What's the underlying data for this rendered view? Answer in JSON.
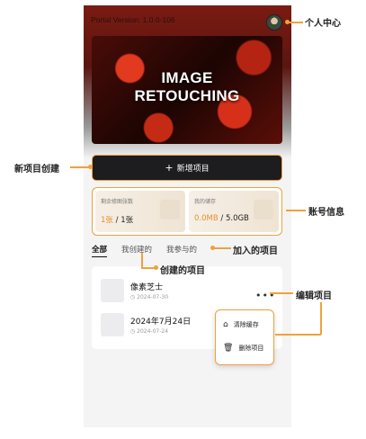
{
  "app": {
    "version_text": "Portal Version: 1.0.0-106",
    "banner_title_line1": "IMAGE",
    "banner_title_line2": "RETOUCHING",
    "new_project_label": "新增项目"
  },
  "account": {
    "remaining_label": "剩余修图张数",
    "remaining_used": "1张",
    "remaining_total": " / 1张",
    "storage_label": "我的储存",
    "storage_used": "0.0MB",
    "storage_total": " / 5.0GB"
  },
  "tabs": [
    {
      "label": "全部",
      "active": true
    },
    {
      "label": "我创建的",
      "active": false
    },
    {
      "label": "我参与的",
      "active": false
    }
  ],
  "projects": [
    {
      "title": "像素芝士",
      "date": "2024-07-30"
    },
    {
      "title": "2024年7月24日",
      "date": "2024-07-24"
    }
  ],
  "more_menu": {
    "more_symbol": "•••",
    "items": [
      {
        "label": "清除缓存",
        "icon": "broom-icon"
      },
      {
        "label": "删除项目",
        "icon": "trash-icon"
      }
    ]
  },
  "annotations": {
    "personal_center": "个人中心",
    "new_project": "新项目创建",
    "account_info": "账号信息",
    "joined_projects": "加入的项目",
    "created_projects": "创建的项目",
    "edit_project": "编辑项目"
  },
  "colors": {
    "accent": "#f0a13a",
    "highlight_value": "#e6902b",
    "button_dark": "#1d1d1f"
  }
}
